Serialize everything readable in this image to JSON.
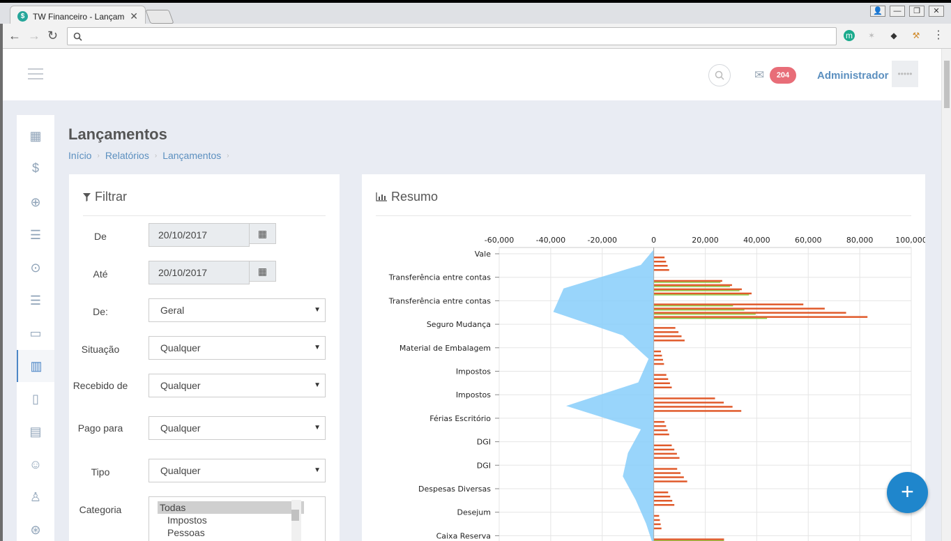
{
  "browser": {
    "tab_title": "TW Financeiro - Lançamento",
    "favicon_letter": "$",
    "address": ""
  },
  "topbar": {
    "notification_count": "204",
    "user_name": "Administrador",
    "avatar_text": "•••••"
  },
  "page": {
    "title": "Lançamentos",
    "breadcrumb": [
      "Início",
      "Relatórios",
      "Lançamentos"
    ]
  },
  "filter": {
    "title": "Filtrar",
    "de_label": "De",
    "de_value": "20/10/2017",
    "ate_label": "Até",
    "ate_value": "20/10/2017",
    "de2_label": "De:",
    "de2_value": "Geral",
    "situacao_label": "Situação",
    "situacao_value": "Qualquer",
    "recebido_label": "Recebido de",
    "recebido_value": "Qualquer",
    "pago_label": "Pago para",
    "pago_value": "Qualquer",
    "tipo_label": "Tipo",
    "tipo_value": "Qualquer",
    "categoria_label": "Categoria",
    "categoria_options": [
      "Todas",
      "Impostos",
      "Pessoas"
    ]
  },
  "resumo": {
    "title": "Resumo"
  },
  "chart_data": {
    "type": "bar",
    "x_ticks": [
      "-60,000",
      "-40,000",
      "-20,000",
      "0",
      "20,000",
      "40,000",
      "60,000",
      "80,000",
      "100,000"
    ],
    "xlim": [
      -60000,
      100000
    ],
    "categories": [
      "Vale",
      "Transferência entre contas",
      "Transferência entre contas",
      "Seguro Mudança",
      "Material de Embalagem",
      "Impostos",
      "Impostos",
      "Férias Escritório",
      "DGI",
      "DGI",
      "Despesas Diversas",
      "Desejum",
      "Caixa Reserva"
    ],
    "series": [
      {
        "color": "#87cefa",
        "shape": "area",
        "values": [
          -5000,
          -35000,
          -39000,
          -12000,
          -2000,
          -6000,
          -34000,
          -5000,
          -10000,
          -12000,
          -7000,
          -3000,
          0
        ]
      },
      {
        "color": "#e05a2b",
        "values": [
          6000,
          38000,
          83000,
          12000,
          4000,
          7000,
          34000,
          6000,
          10000,
          13000,
          8000,
          3000,
          39000
        ]
      },
      {
        "color": "#8cc63f",
        "values": [
          0,
          37000,
          44000,
          0,
          0,
          0,
          0,
          0,
          0,
          0,
          0,
          0,
          39000
        ]
      }
    ],
    "grid": true
  },
  "colors": {
    "accent": "#4c86c6",
    "badge": "#e86d78",
    "fab": "#1f86cc"
  }
}
